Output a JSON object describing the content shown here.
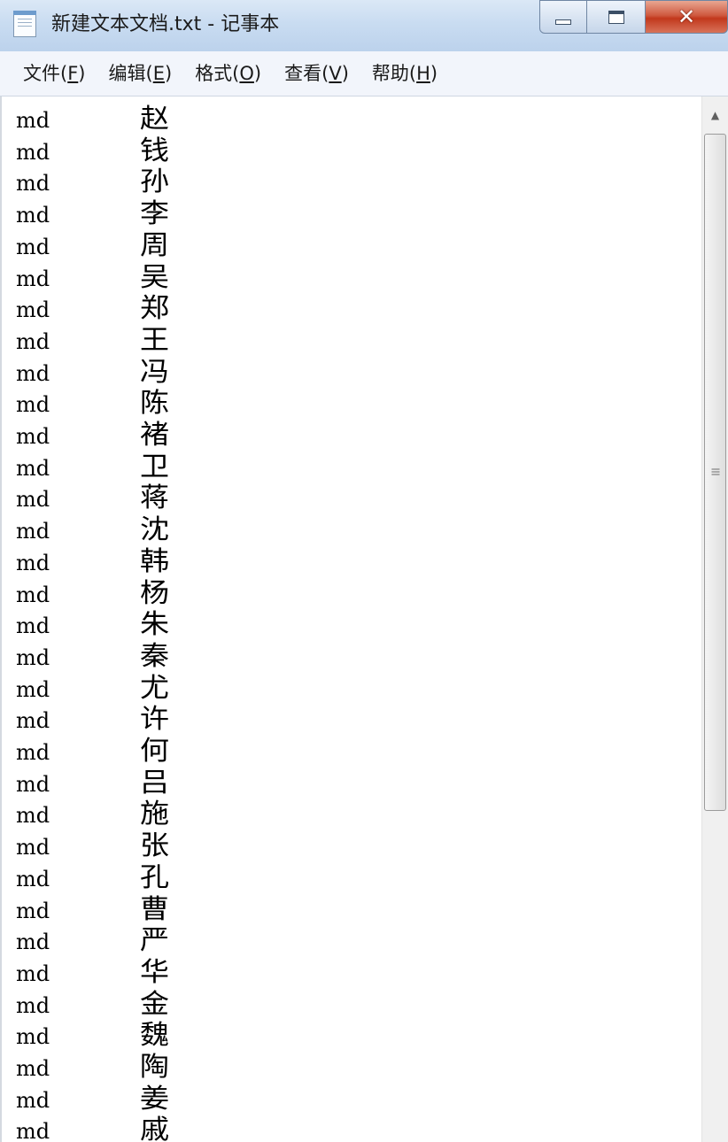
{
  "window": {
    "title": "新建文本文档.txt - 记事本",
    "icon": "notepad-icon",
    "controls": {
      "minimize": "minimize-icon",
      "maximize": "maximize-icon",
      "close": "close-icon",
      "close_color": "#c2381c"
    }
  },
  "menu": [
    {
      "text": "文件(",
      "key": "F",
      "end": ")"
    },
    {
      "text": "编辑(",
      "key": "E",
      "end": ")"
    },
    {
      "text": "格式(",
      "key": "O",
      "end": ")"
    },
    {
      "text": "查看(",
      "key": "V",
      "end": ")"
    },
    {
      "text": "帮助(",
      "key": "H",
      "end": ")"
    }
  ],
  "document": {
    "lines": [
      {
        "prefix": "md",
        "name": "赵"
      },
      {
        "prefix": "md",
        "name": "钱"
      },
      {
        "prefix": "md",
        "name": "孙"
      },
      {
        "prefix": "md",
        "name": "李"
      },
      {
        "prefix": "md",
        "name": "周"
      },
      {
        "prefix": "md",
        "name": "吴"
      },
      {
        "prefix": "md",
        "name": "郑"
      },
      {
        "prefix": "md",
        "name": "王"
      },
      {
        "prefix": "md",
        "name": "冯"
      },
      {
        "prefix": "md",
        "name": "陈"
      },
      {
        "prefix": "md",
        "name": "褚"
      },
      {
        "prefix": "md",
        "name": "卫"
      },
      {
        "prefix": "md",
        "name": "蒋"
      },
      {
        "prefix": "md",
        "name": "沈"
      },
      {
        "prefix": "md",
        "name": "韩"
      },
      {
        "prefix": "md",
        "name": "杨"
      },
      {
        "prefix": "md",
        "name": "朱"
      },
      {
        "prefix": "md",
        "name": "秦"
      },
      {
        "prefix": "md",
        "name": "尤"
      },
      {
        "prefix": "md",
        "name": "许"
      },
      {
        "prefix": "md",
        "name": "何"
      },
      {
        "prefix": "md",
        "name": "吕"
      },
      {
        "prefix": "md",
        "name": "施"
      },
      {
        "prefix": "md",
        "name": "张"
      },
      {
        "prefix": "md",
        "name": "孔"
      },
      {
        "prefix": "md",
        "name": "曹"
      },
      {
        "prefix": "md",
        "name": "严"
      },
      {
        "prefix": "md",
        "name": "华"
      },
      {
        "prefix": "md",
        "name": "金"
      },
      {
        "prefix": "md",
        "name": "魏"
      },
      {
        "prefix": "md",
        "name": "陶"
      },
      {
        "prefix": "md",
        "name": "姜"
      },
      {
        "prefix": "md",
        "name": "戚"
      }
    ]
  },
  "scrollbar": {
    "up_arrow": "▲",
    "thumb_grip": "grip-icon"
  }
}
